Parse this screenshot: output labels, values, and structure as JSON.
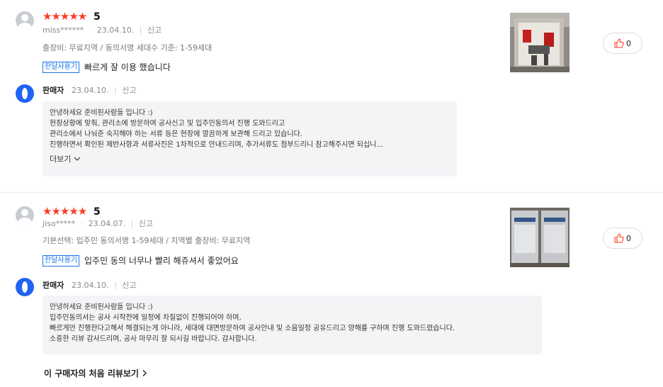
{
  "reviews": [
    {
      "stars": "★★★★★",
      "score": "5",
      "user": "miss******",
      "date": "23.04.10.",
      "report": "신고",
      "options": "출장비: 무료지역 / 동의서명 세대수 기준: 1-59세대",
      "tag": "한달사용기",
      "text": "빠르게 잘 이용 했습니다",
      "likes": "0",
      "seller": {
        "name": "판매자",
        "date": "23.04.10.",
        "report": "신고",
        "lines": [
          "안녕하세요 준비된사람들 입니다 :)",
          "현장상황에 맞춰, 관리소에 방문하여 공사신고 및 입주민동의서 진행 도와드리고",
          "관리소에서 나눠준 숙지해야 하는 서류 등은 현장에 깔끔하게 보관해 드리고 있습니다.",
          "진행하면서 확인된 제반사항과 서류사진은 1차적으로 안내드리며, 추가서류도 첨부드리니 참고해주시면 되십니..."
        ],
        "more": "더보기"
      }
    },
    {
      "stars": "★★★★★",
      "score": "5",
      "user": "jiso*****",
      "date": "23.04.07.",
      "report": "신고",
      "options": "기본선택: 입주민 동의서명 1-59세대 / 지역별 출장비: 무료지역",
      "tag": "한달사용기",
      "text": "입주민 동의 너무나 빨리 해쥬셔서 좋았어요",
      "likes": "0",
      "seller": {
        "name": "판매자",
        "date": "23.04.10.",
        "report": "신고",
        "lines": [
          "안녕하세요 준비된사람들 입니다 :)",
          "입주민동의서는 공사 시작전에 일정에 차질없이 진행되어야 하며,",
          "빠르게만 진행한다고해서 해결되는게 아니라, 세대에 대면방문하여 공사안내 및 소음일정 공유드리고 양해를 구하며 진행 도와드렸습니다.",
          "소중한 리뷰 감사드리며, 공사 마무리 잘 되시길 바랍니다. 감사합니다."
        ]
      }
    }
  ],
  "first_review_link": "이 구매자의 처음 리뷰보기",
  "colors": {
    "star": "#ff3a24",
    "tag": "#1a73e8",
    "seller_logo": "#2163f3",
    "reply_bg": "#f3f4f6"
  }
}
